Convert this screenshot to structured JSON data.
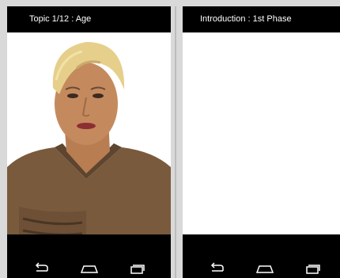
{
  "left_phone": {
    "topic_label": "Topic 1/12 : Age",
    "icons": {
      "back": "back-arrow-icon",
      "home": "home-icon",
      "recents": "recent-apps-icon"
    }
  },
  "right_phone": {
    "phase_label": "Introduction : 1st Phase",
    "icons": {
      "back": "back-arrow-icon",
      "home": "home-icon",
      "recents": "recent-apps-icon"
    }
  },
  "colors": {
    "bar": "#000000",
    "screen": "#ffffff",
    "bezel": "#d9d9d9",
    "hair": "#e6cf8a",
    "skin": "#c48a5e",
    "shirt": "#7a5a3c"
  }
}
